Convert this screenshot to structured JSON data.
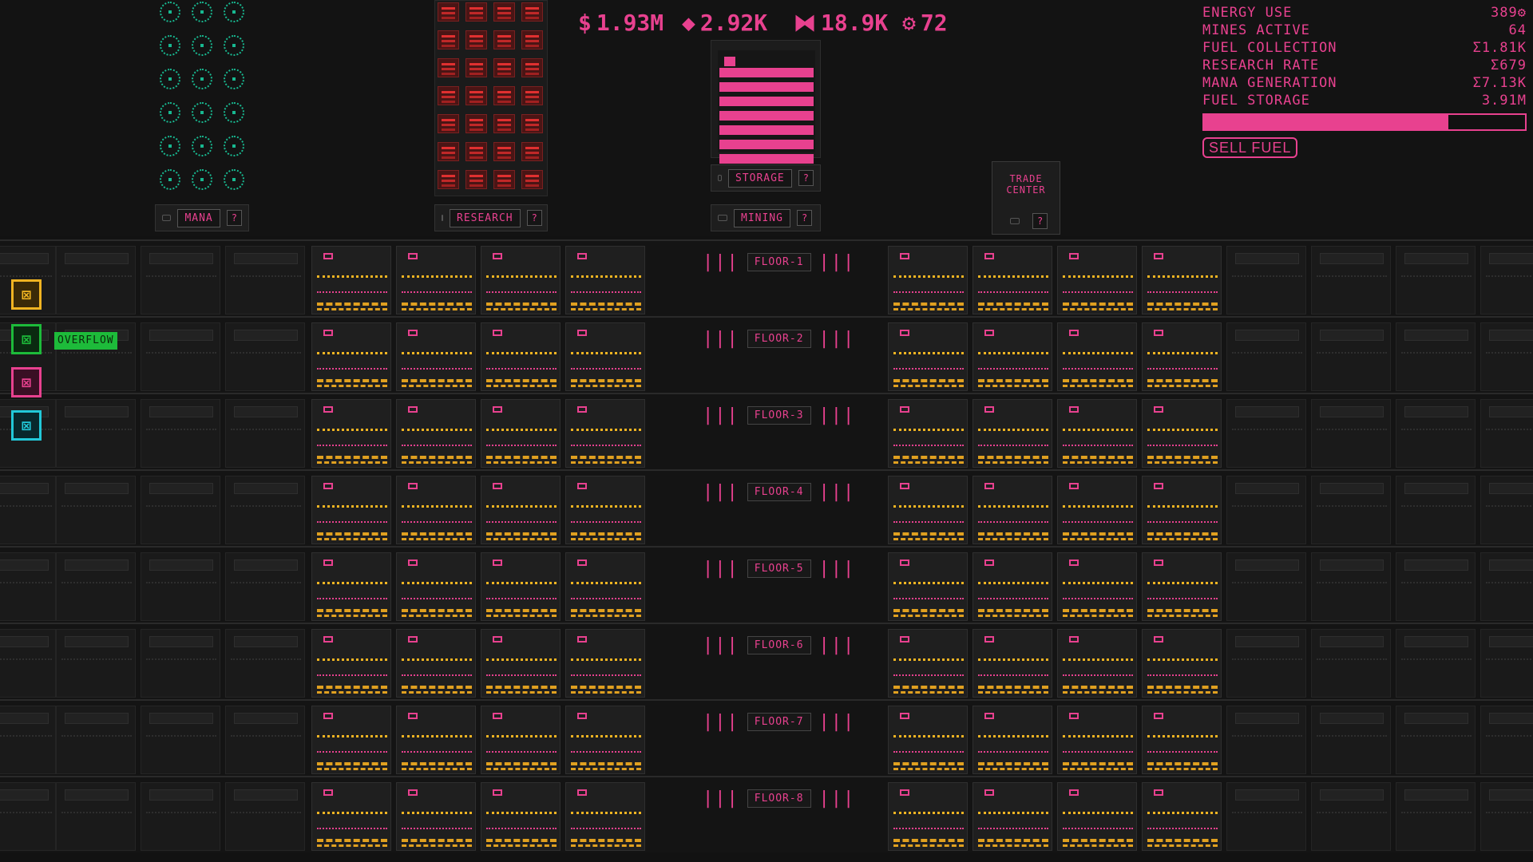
{
  "currencies": [
    {
      "icon": "$",
      "icon_name": "dollar-icon",
      "value": "1.93M"
    },
    {
      "icon": "◆",
      "icon_name": "research-icon",
      "value": "2.92K"
    },
    {
      "icon": "⧓",
      "icon_name": "mana-icon",
      "value": "18.9K"
    },
    {
      "icon": "⚙",
      "icon_name": "gear-icon",
      "value": "72"
    }
  ],
  "stats": [
    {
      "label": "ENERGY USE",
      "value": "389⚙"
    },
    {
      "label": "MINES ACTIVE",
      "value": "64"
    },
    {
      "label": "FUEL COLLECTION",
      "value": "Σ1.81K"
    },
    {
      "label": "RESEARCH RATE",
      "value": "Σ679"
    },
    {
      "label": "MANA GENERATION",
      "value": "Σ7.13K"
    },
    {
      "label": "FUEL STORAGE",
      "value": "3.91M"
    }
  ],
  "fuel_storage_fill": 0.76,
  "sell_button": "SELL FUEL",
  "buildings": {
    "mana": "MANA",
    "research": "RESEARCH",
    "storage": "STORAGE",
    "mining": "MINING",
    "trade": "TRADE CENTER",
    "help": "?"
  },
  "overflow_label": "OVERFLOW",
  "floors": [
    "FLOOR-1",
    "FLOOR-2",
    "FLOOR-3",
    "FLOOR-4",
    "FLOOR-5",
    "FLOOR-6",
    "FLOOR-7",
    "FLOOR-8"
  ],
  "block_colors": [
    "#f0b422",
    "#1dbb3a",
    "#e8418f",
    "#22c8d8"
  ],
  "accent_color": "#e8418f"
}
